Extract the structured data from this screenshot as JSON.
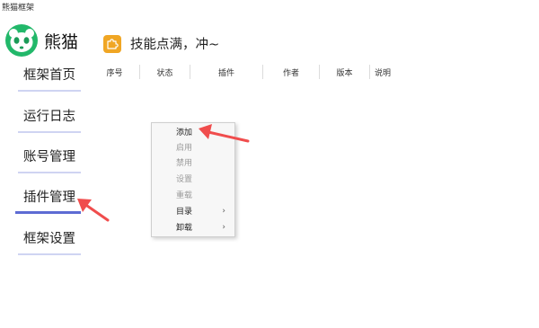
{
  "window": {
    "title": "熊猫框架"
  },
  "brand": {
    "name": "熊猫",
    "logo_icon": "panda-icon"
  },
  "nav": {
    "items": [
      {
        "label": "框架首页",
        "active": false
      },
      {
        "label": "运行日志",
        "active": false
      },
      {
        "label": "账号管理",
        "active": false
      },
      {
        "label": "插件管理",
        "active": true
      },
      {
        "label": "框架设置",
        "active": false
      }
    ]
  },
  "header": {
    "tip": "技能点满，冲~",
    "tip_icon": "puzzle-piece-icon"
  },
  "table": {
    "columns": [
      "序号",
      "状态",
      "插件",
      "作者",
      "版本",
      "说明"
    ]
  },
  "context_menu": {
    "items": [
      {
        "label": "添加",
        "enabled": true
      },
      {
        "label": "启用",
        "enabled": false
      },
      {
        "label": "禁用",
        "enabled": false
      },
      {
        "label": "设置",
        "enabled": false
      },
      {
        "label": "重载",
        "enabled": false
      },
      {
        "label": "目录",
        "enabled": true,
        "submenu": true,
        "arrow": "›"
      },
      {
        "label": "卸载",
        "enabled": true,
        "submenu": true,
        "arrow": "›"
      }
    ]
  },
  "colors": {
    "nav_active_underline": "#5d6bd3",
    "nav_underline": "#cfd4f2",
    "tip_icon": "#f0a624",
    "annotation_arrow": "#f04d4d",
    "logo": "#22b86a"
  }
}
